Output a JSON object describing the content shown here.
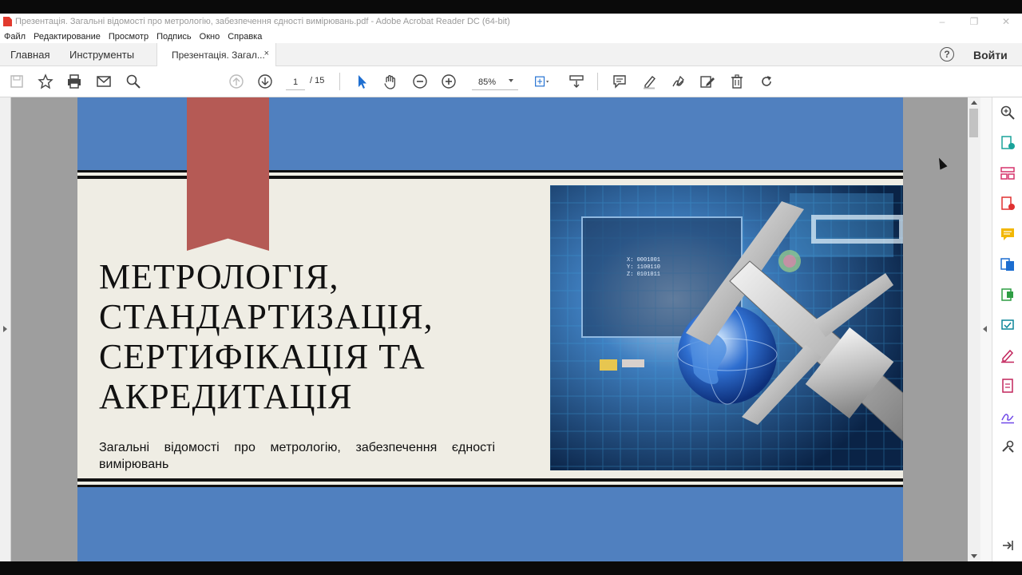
{
  "window": {
    "title": "Презентація. Загальні відомості про метрологію, забезпечення єдності вимірювань.pdf - Adobe Acrobat Reader DC (64-bit)",
    "controls": [
      "–",
      "❐",
      "✕"
    ]
  },
  "menu": [
    "Файл",
    "Редактирование",
    "Просмотр",
    "Подпись",
    "Окно",
    "Справка"
  ],
  "tabs": {
    "home": "Главная",
    "tools": "Инструменты",
    "document": "Презентація. Загал...",
    "close": "×"
  },
  "header": {
    "help": "?",
    "login": "Войти"
  },
  "toolbar": {
    "page_current": "1",
    "page_total": "/ 15",
    "zoom": "85%",
    "icons": [
      "save-icon",
      "bookmark-star-icon",
      "print-icon",
      "email-icon",
      "search-icon",
      "page-up-icon",
      "page-down-icon",
      "select-cursor-icon",
      "hand-icon",
      "zoom-out-icon",
      "zoom-in-icon",
      "fit-page-icon",
      "scroll-mode-icon",
      "comment-icon",
      "highlight-icon",
      "sign-icon",
      "stamp-icon",
      "delete-icon",
      "rotate-icon"
    ]
  },
  "slide": {
    "heading_lines": [
      "МЕТРОЛОГІЯ,",
      "СТАНДАРТИЗАЦІЯ,",
      "СЕРТИФІКАЦІЯ ТА",
      "АКРЕДИТАЦІЯ"
    ],
    "subtitle": "Загальні відомості про метрологію, забезпечення єдності вимірювань",
    "image_readout": [
      "X: 0001001",
      "Y: 1100110",
      "Z: 0101011"
    ],
    "colors": {
      "frame": "#5080bf",
      "band": "#efede4",
      "ribbon": "#b55a55"
    }
  },
  "right_panel": {
    "icons": [
      "zoom-tool-icon",
      "export-pdf-icon",
      "organize-pages-icon",
      "create-pdf-icon",
      "comment-tool-icon",
      "combine-files-icon",
      "edit-pdf-icon",
      "compress-pdf-icon",
      "fill-sign-icon",
      "document-icon",
      "signature-icon",
      "more-tools-icon",
      "panel-collapse-icon"
    ]
  }
}
